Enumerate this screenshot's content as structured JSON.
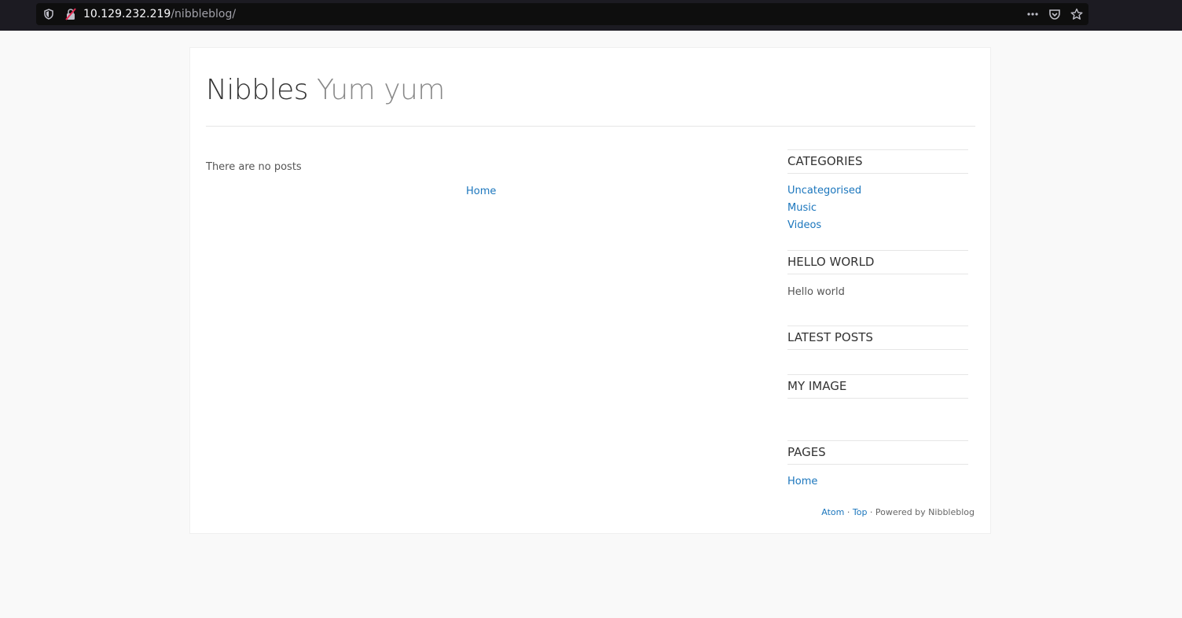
{
  "browser": {
    "url_host": "10.129.232.219",
    "url_path": "/nibbleblog/",
    "icons": [
      "shield-icon",
      "insecure-lock-icon",
      "more-icon",
      "pocket-icon",
      "bookmark-star-icon"
    ]
  },
  "site": {
    "name": "Nibbles",
    "slogan": "Yum yum"
  },
  "main": {
    "empty_message": "There are no posts",
    "nav_link": "Home"
  },
  "sidebar": {
    "categories": {
      "title": "CATEGORIES",
      "items": [
        "Uncategorised",
        "Music",
        "Videos"
      ]
    },
    "hello_world": {
      "title": "HELLO WORLD",
      "text": "Hello world"
    },
    "latest_posts": {
      "title": "LATEST POSTS"
    },
    "my_image": {
      "title": "MY IMAGE"
    },
    "pages": {
      "title": "PAGES",
      "items": [
        "Home"
      ]
    }
  },
  "footer": {
    "atom": "Atom",
    "separator": " · ",
    "top": "Top",
    "powered": "Powered by Nibbleblog"
  },
  "colors": {
    "link": "#1b76bd",
    "page_bg": "#f9f9f9",
    "browser_bar": "#1c1b22"
  }
}
